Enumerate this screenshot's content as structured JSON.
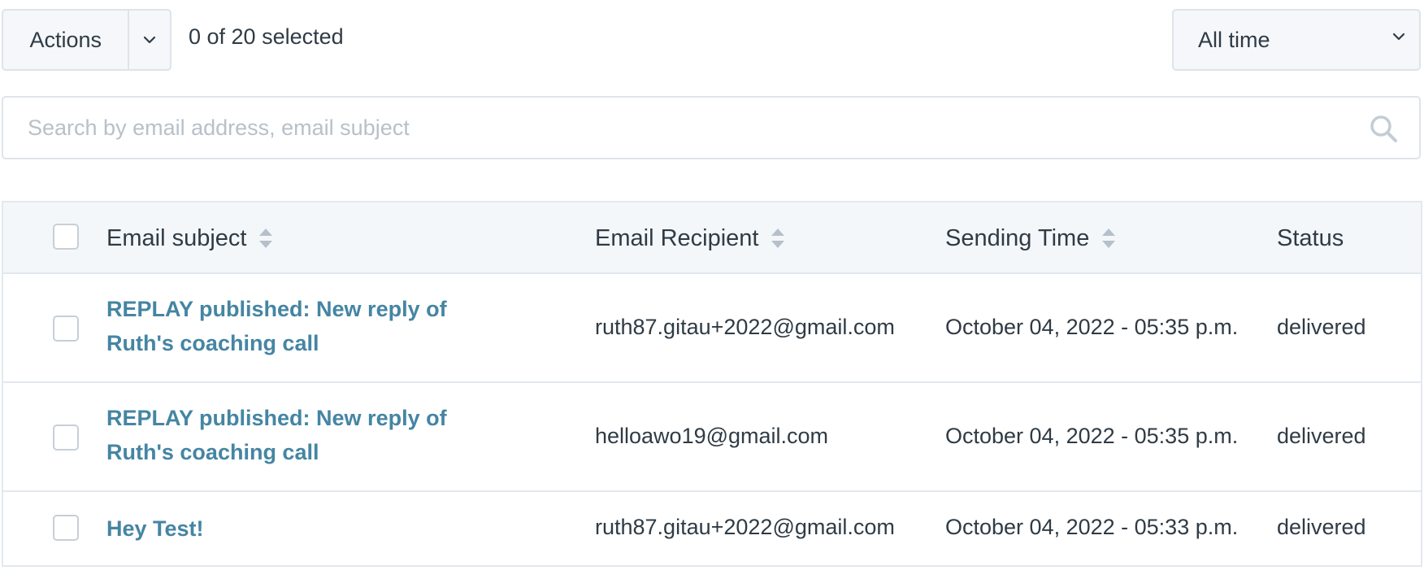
{
  "toolbar": {
    "actions_label": "Actions",
    "selection_text": "0 of 20 selected",
    "time_filter": {
      "selected": "All time"
    }
  },
  "search": {
    "placeholder": "Search by email address, email subject",
    "value": ""
  },
  "table": {
    "columns": {
      "subject": "Email subject",
      "recipient": "Email Recipient",
      "time": "Sending Time",
      "status": "Status"
    },
    "rows": [
      {
        "subject": "REPLAY published: New reply of Ruth's coaching call",
        "recipient": "ruth87.gitau+2022@gmail.com",
        "time": "October 04, 2022 - 05:35 p.m.",
        "status": "delivered"
      },
      {
        "subject": "REPLAY published: New reply of Ruth's coaching call",
        "recipient": "helloawo19@gmail.com",
        "time": "October 04, 2022 - 05:35 p.m.",
        "status": "delivered"
      },
      {
        "subject": "Hey Test!",
        "recipient": "ruth87.gitau+2022@gmail.com",
        "time": "October 04, 2022 - 05:33 p.m.",
        "status": "delivered"
      }
    ]
  },
  "colors": {
    "link": "#4585a3",
    "border": "#dfe4ea",
    "header_bg": "#f4f7fa",
    "text": "#2f3b45",
    "placeholder": "#b8c0c8"
  },
  "icons": {
    "actions_dropdown": "chevron-down-icon",
    "time_dropdown": "chevron-down-icon",
    "search": "search-icon",
    "sort": "sort-icon"
  }
}
